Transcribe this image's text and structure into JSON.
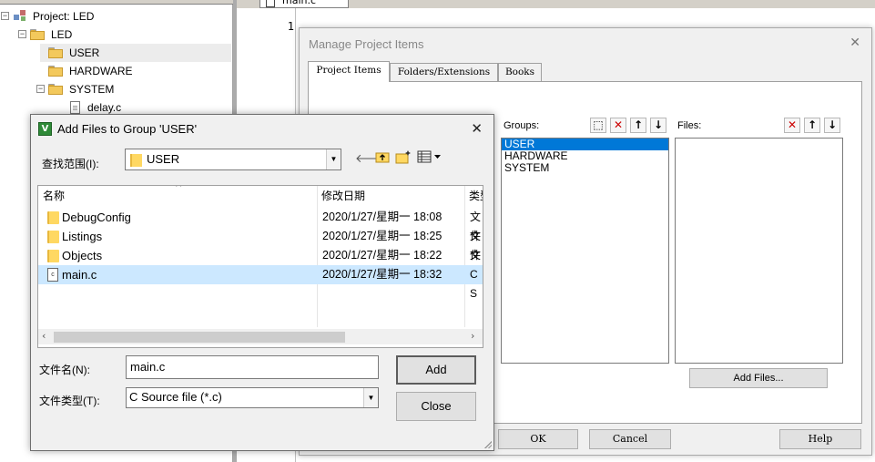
{
  "project": {
    "root_label": "Project: LED",
    "target_label": "LED",
    "groups": [
      {
        "label": "USER"
      },
      {
        "label": "HARDWARE"
      },
      {
        "label": "SYSTEM"
      }
    ],
    "system_file": "delay.c"
  },
  "editor": {
    "tab_label": "main.c",
    "line_numbers": [
      "1"
    ]
  },
  "manage_dialog": {
    "title": "Manage Project Items",
    "close_glyph": "✕",
    "tabs": [
      "Project Items",
      "Folders/Extensions",
      "Books"
    ],
    "groups_label": "Groups:",
    "files_label": "Files:",
    "groups": [
      "USER",
      "HARDWARE",
      "SYSTEM"
    ],
    "selected_group": "USER",
    "add_files_button": "Add Files...",
    "ok_button": "OK",
    "cancel_button": "Cancel",
    "help_button": "Help"
  },
  "add_dialog": {
    "title": "Add Files to Group 'USER'",
    "close_glyph": "✕",
    "look_in_label": "查找范围(I):",
    "look_in_value": "USER",
    "columns": {
      "name": "名称",
      "modified": "修改日期",
      "type": "类型"
    },
    "files": [
      {
        "kind": "folder",
        "name": "DebugConfig",
        "date": "2020/1/27/星期一 18:08",
        "type": "文件"
      },
      {
        "kind": "folder",
        "name": "Listings",
        "date": "2020/1/27/星期一 18:25",
        "type": "文件"
      },
      {
        "kind": "folder",
        "name": "Objects",
        "date": "2020/1/27/星期一 18:22",
        "type": "文件"
      },
      {
        "kind": "c-file",
        "name": "main.c",
        "date": "2020/1/27/星期一 18:32",
        "type": "C S"
      }
    ],
    "filename_label": "文件名(N):",
    "filename_value": "main.c",
    "filetype_label": "文件类型(T):",
    "filetype_value": "C Source file (*.c)",
    "add_button": "Add",
    "close_button": "Close"
  },
  "colors": {
    "selection_blue": "#0078d7",
    "row_highlight": "#cce8ff",
    "delete_red": "#cc0000"
  }
}
